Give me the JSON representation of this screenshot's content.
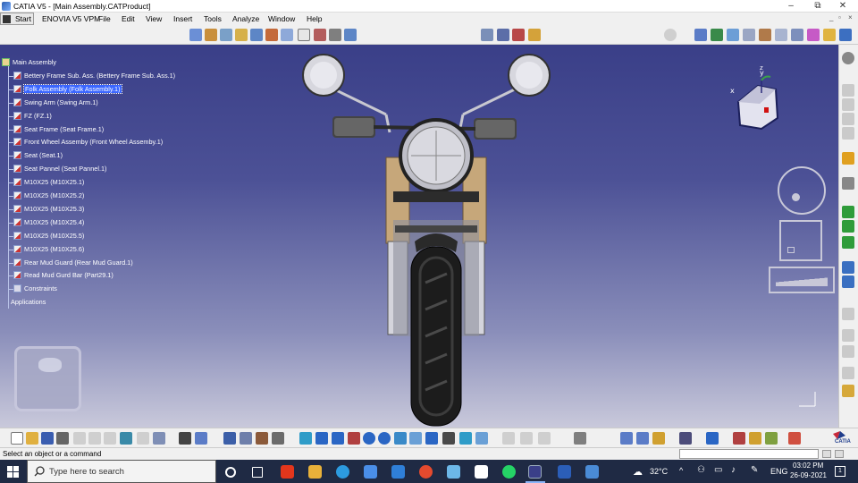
{
  "window": {
    "title": "CATIA V5 - [Main Assembly.CATProduct]",
    "controls": [
      "–",
      "⧉",
      "✕"
    ]
  },
  "menubar": {
    "start_label": "Start",
    "items": [
      "ENOVIA V5 VPM",
      "File",
      "Edit",
      "View",
      "Insert",
      "Tools",
      "Analyze",
      "Window",
      "Help"
    ],
    "doc_controls": [
      "_",
      "▫",
      "×"
    ]
  },
  "tree": {
    "root": "Main Assembly",
    "nodes": [
      "Bettery Frame Sub. Ass. (Bettery Frame Sub. Ass.1)",
      "Folk Assembly (Folk Assembly.1)",
      "Swing Arm (Swing Arm.1)",
      "FZ (FZ.1)",
      "Seat Frame (Seat Frame.1)",
      "Front Wheel Assemby (Front Wheel Assemby.1)",
      "Seat (Seat.1)",
      "Seat Pannel (Seat Pannel.1)",
      "M10X25 (M10X25.1)",
      "M10X25 (M10X25.2)",
      "M10X25 (M10X25.3)",
      "M10X25 (M10X25.4)",
      "M10X25 (M10X25.5)",
      "M10X25 (M10X25.6)",
      "Rear Mud Guard (Rear Mud Guard.1)",
      "Read Mud Gurd Bar (Part29.1)",
      "Constraints"
    ],
    "selected_index": 1,
    "applications": "Applications"
  },
  "compass": {
    "x_label": "x",
    "y_label": "y",
    "z_label": "z"
  },
  "statusbar": {
    "message": "Select an object or a command",
    "command_input": ""
  },
  "taskbar": {
    "search_placeholder": "Type here to search",
    "temperature": "32°C",
    "language": "ENG",
    "time": "03:02 PM",
    "date": "26-09-2021",
    "notification_count": "1"
  },
  "brand": {
    "logo_text": "CATIA"
  },
  "colors": {
    "viewport_top": "#3a3f88",
    "viewport_bottom": "#c9c9db",
    "selection": "#3a66ff",
    "taskbar": "#1f2a44"
  }
}
